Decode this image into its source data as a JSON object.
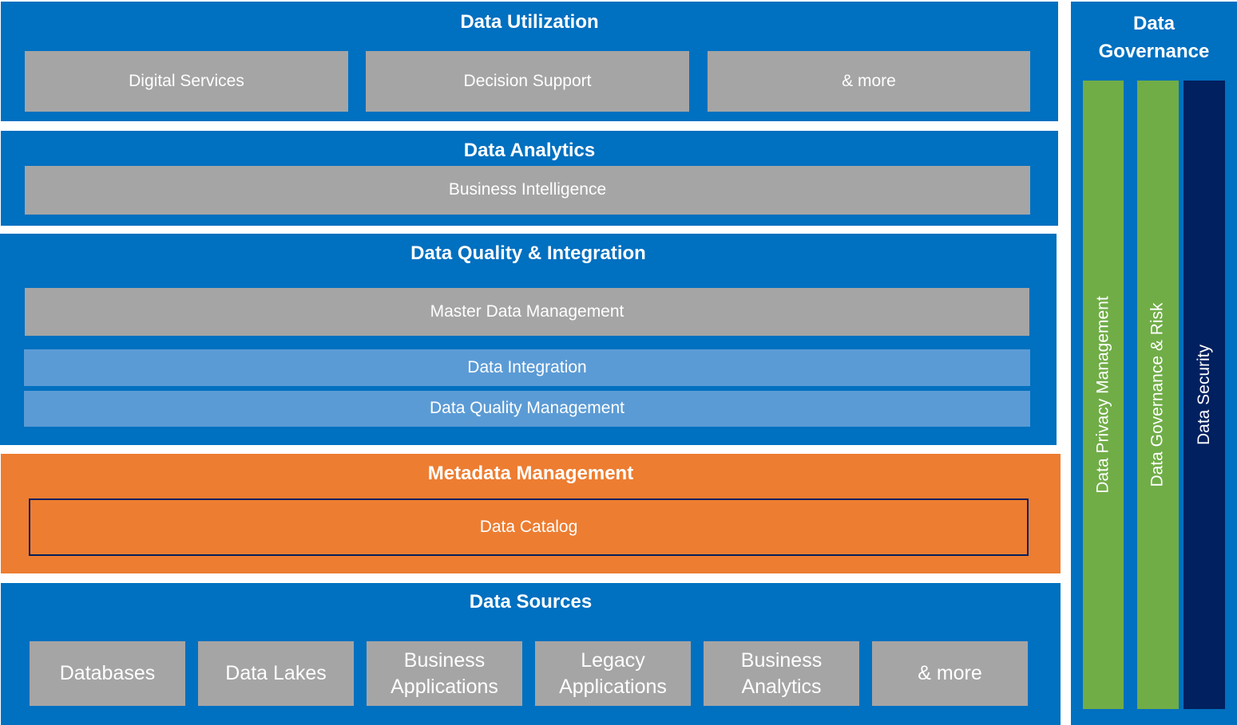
{
  "layers": {
    "utilization": {
      "title": "Data Utilization",
      "items": [
        "Digital Services",
        "Decision Support",
        "& more"
      ]
    },
    "analytics": {
      "title": "Data Analytics",
      "items": [
        "Business Intelligence"
      ]
    },
    "quality_integration": {
      "title": "Data Quality & Integration",
      "items": [
        "Master Data Management",
        "Data Integration",
        "Data Quality Management"
      ]
    },
    "metadata": {
      "title": "Metadata Management",
      "items": [
        "Data Catalog"
      ]
    },
    "sources": {
      "title": "Data Sources",
      "items": [
        "Databases",
        "Data Lakes",
        "Business Applications",
        "Legacy Applications",
        "Business Analytics",
        "& more"
      ]
    }
  },
  "governance": {
    "title": "Data Governance",
    "pillars": [
      "Data Privacy Management",
      "Data Governance & Risk",
      "Data Security"
    ]
  },
  "colors": {
    "layer_blue": "#0070c0",
    "box_gray": "#a5a5a5",
    "box_light_blue": "#5b9bd5",
    "metadata_orange": "#ed7d31",
    "outline_navy": "#002060",
    "pillar_green": "#70ad47",
    "pillar_navy": "#002060"
  }
}
